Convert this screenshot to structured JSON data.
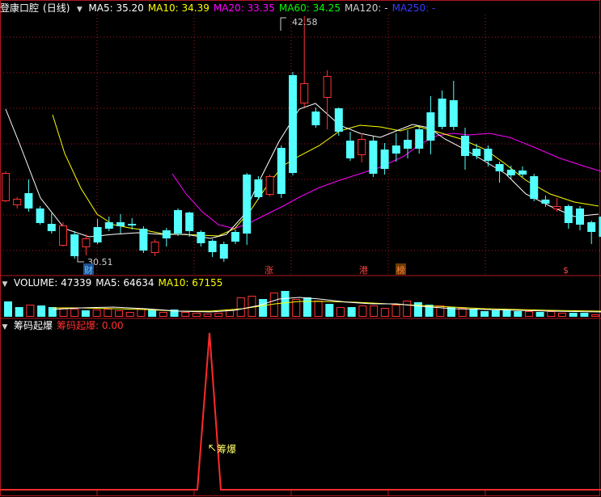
{
  "stock": {
    "name": "登康口腔",
    "period": "(日线)"
  },
  "price_panel": {
    "legend": [
      {
        "label": "MA5: 35.20",
        "color": "#ffffff"
      },
      {
        "label": "MA10: 34.39",
        "color": "#ffff00"
      },
      {
        "label": "MA20: 33.35",
        "color": "#ff00ff"
      },
      {
        "label": "MA60: 34.25",
        "color": "#00ff00"
      },
      {
        "label": "MA120: -",
        "color": "#cfcfcf"
      },
      {
        "label": "MA250: -",
        "color": "#3a3aff"
      }
    ],
    "high_label": "42.58",
    "low_label": "30.51",
    "markers": [
      {
        "text": "财",
        "color": "#66ccff",
        "bg": "#1f4f8f"
      },
      {
        "text": "涨",
        "color": "#ff4040",
        "bg": ""
      },
      {
        "text": "港",
        "color": "#ff4040",
        "bg": ""
      },
      {
        "text": "榜",
        "color": "#ff7f3f",
        "bg": "#6a3b00"
      },
      {
        "text": "$",
        "color": "#ff4040",
        "bg": ""
      }
    ]
  },
  "volume_panel": {
    "legend": [
      {
        "label": "VOLUME: 47339",
        "color": "#ffffff"
      },
      {
        "label": "MA5: 64634",
        "color": "#ffffff"
      },
      {
        "label": "MA10: 67155",
        "color": "#ffff00"
      }
    ]
  },
  "indicator_panel": {
    "legend": [
      {
        "label": "筹码起爆",
        "color": "#ffffff"
      },
      {
        "label": "筹码起爆: 0.00",
        "color": "#ff3030"
      }
    ],
    "signal_label": "筹爆"
  },
  "colors": {
    "up": "#ff3232",
    "down": "#54ffff",
    "ma5": "#ffffff",
    "ma10": "#ffff00",
    "ma20": "#ff00ff",
    "grid": "#b0171f",
    "indicator": "#ff2a2a"
  },
  "chart_data": {
    "type": "candlestick",
    "indicator": {
      "name": "筹码起爆",
      "value": 0.0
    }
  }
}
